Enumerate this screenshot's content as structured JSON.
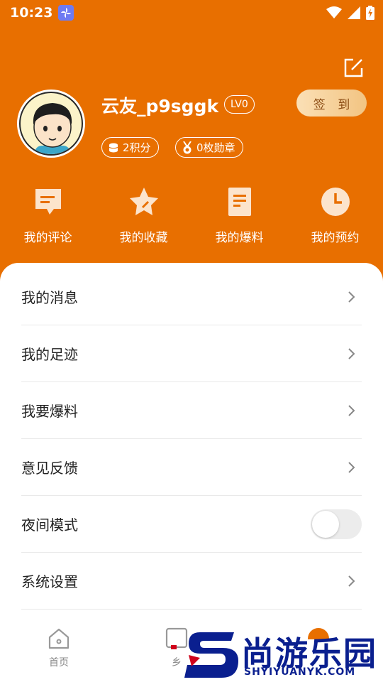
{
  "status_bar": {
    "time": "10:23",
    "icons": [
      "app-pinwheel-icon",
      "wifi-icon",
      "cellular-icon",
      "battery-charging-icon"
    ]
  },
  "header": {
    "edit_icon": "edit-icon",
    "username": "云友_p9sggk",
    "level": "LV0",
    "checkin_label": "签 到",
    "points": "2积分",
    "medals": "0枚勋章"
  },
  "quick_actions": [
    {
      "label": "我的评论",
      "icon": "comment-icon"
    },
    {
      "label": "我的收藏",
      "icon": "star-icon"
    },
    {
      "label": "我的爆料",
      "icon": "document-icon"
    },
    {
      "label": "我的预约",
      "icon": "clock-icon"
    }
  ],
  "menu": [
    {
      "label": "我的消息"
    },
    {
      "label": "我的足迹"
    },
    {
      "label": "我要爆料"
    },
    {
      "label": "意见反馈"
    },
    {
      "label": "夜间模式",
      "toggle": false
    },
    {
      "label": "系统设置"
    }
  ],
  "tabbar": [
    {
      "label": "首页",
      "icon": "home-icon"
    },
    {
      "label": "乡",
      "icon": "tab-icon"
    }
  ],
  "watermark": {
    "text": "尚游乐园",
    "url": "SHYIYUANYK.COM"
  },
  "colors": {
    "primary": "#E86F00",
    "checkin_gradient_start": "#FBE0B6",
    "checkin_gradient_end": "#F2C482",
    "watermark_blue": "#0A1F8F"
  }
}
